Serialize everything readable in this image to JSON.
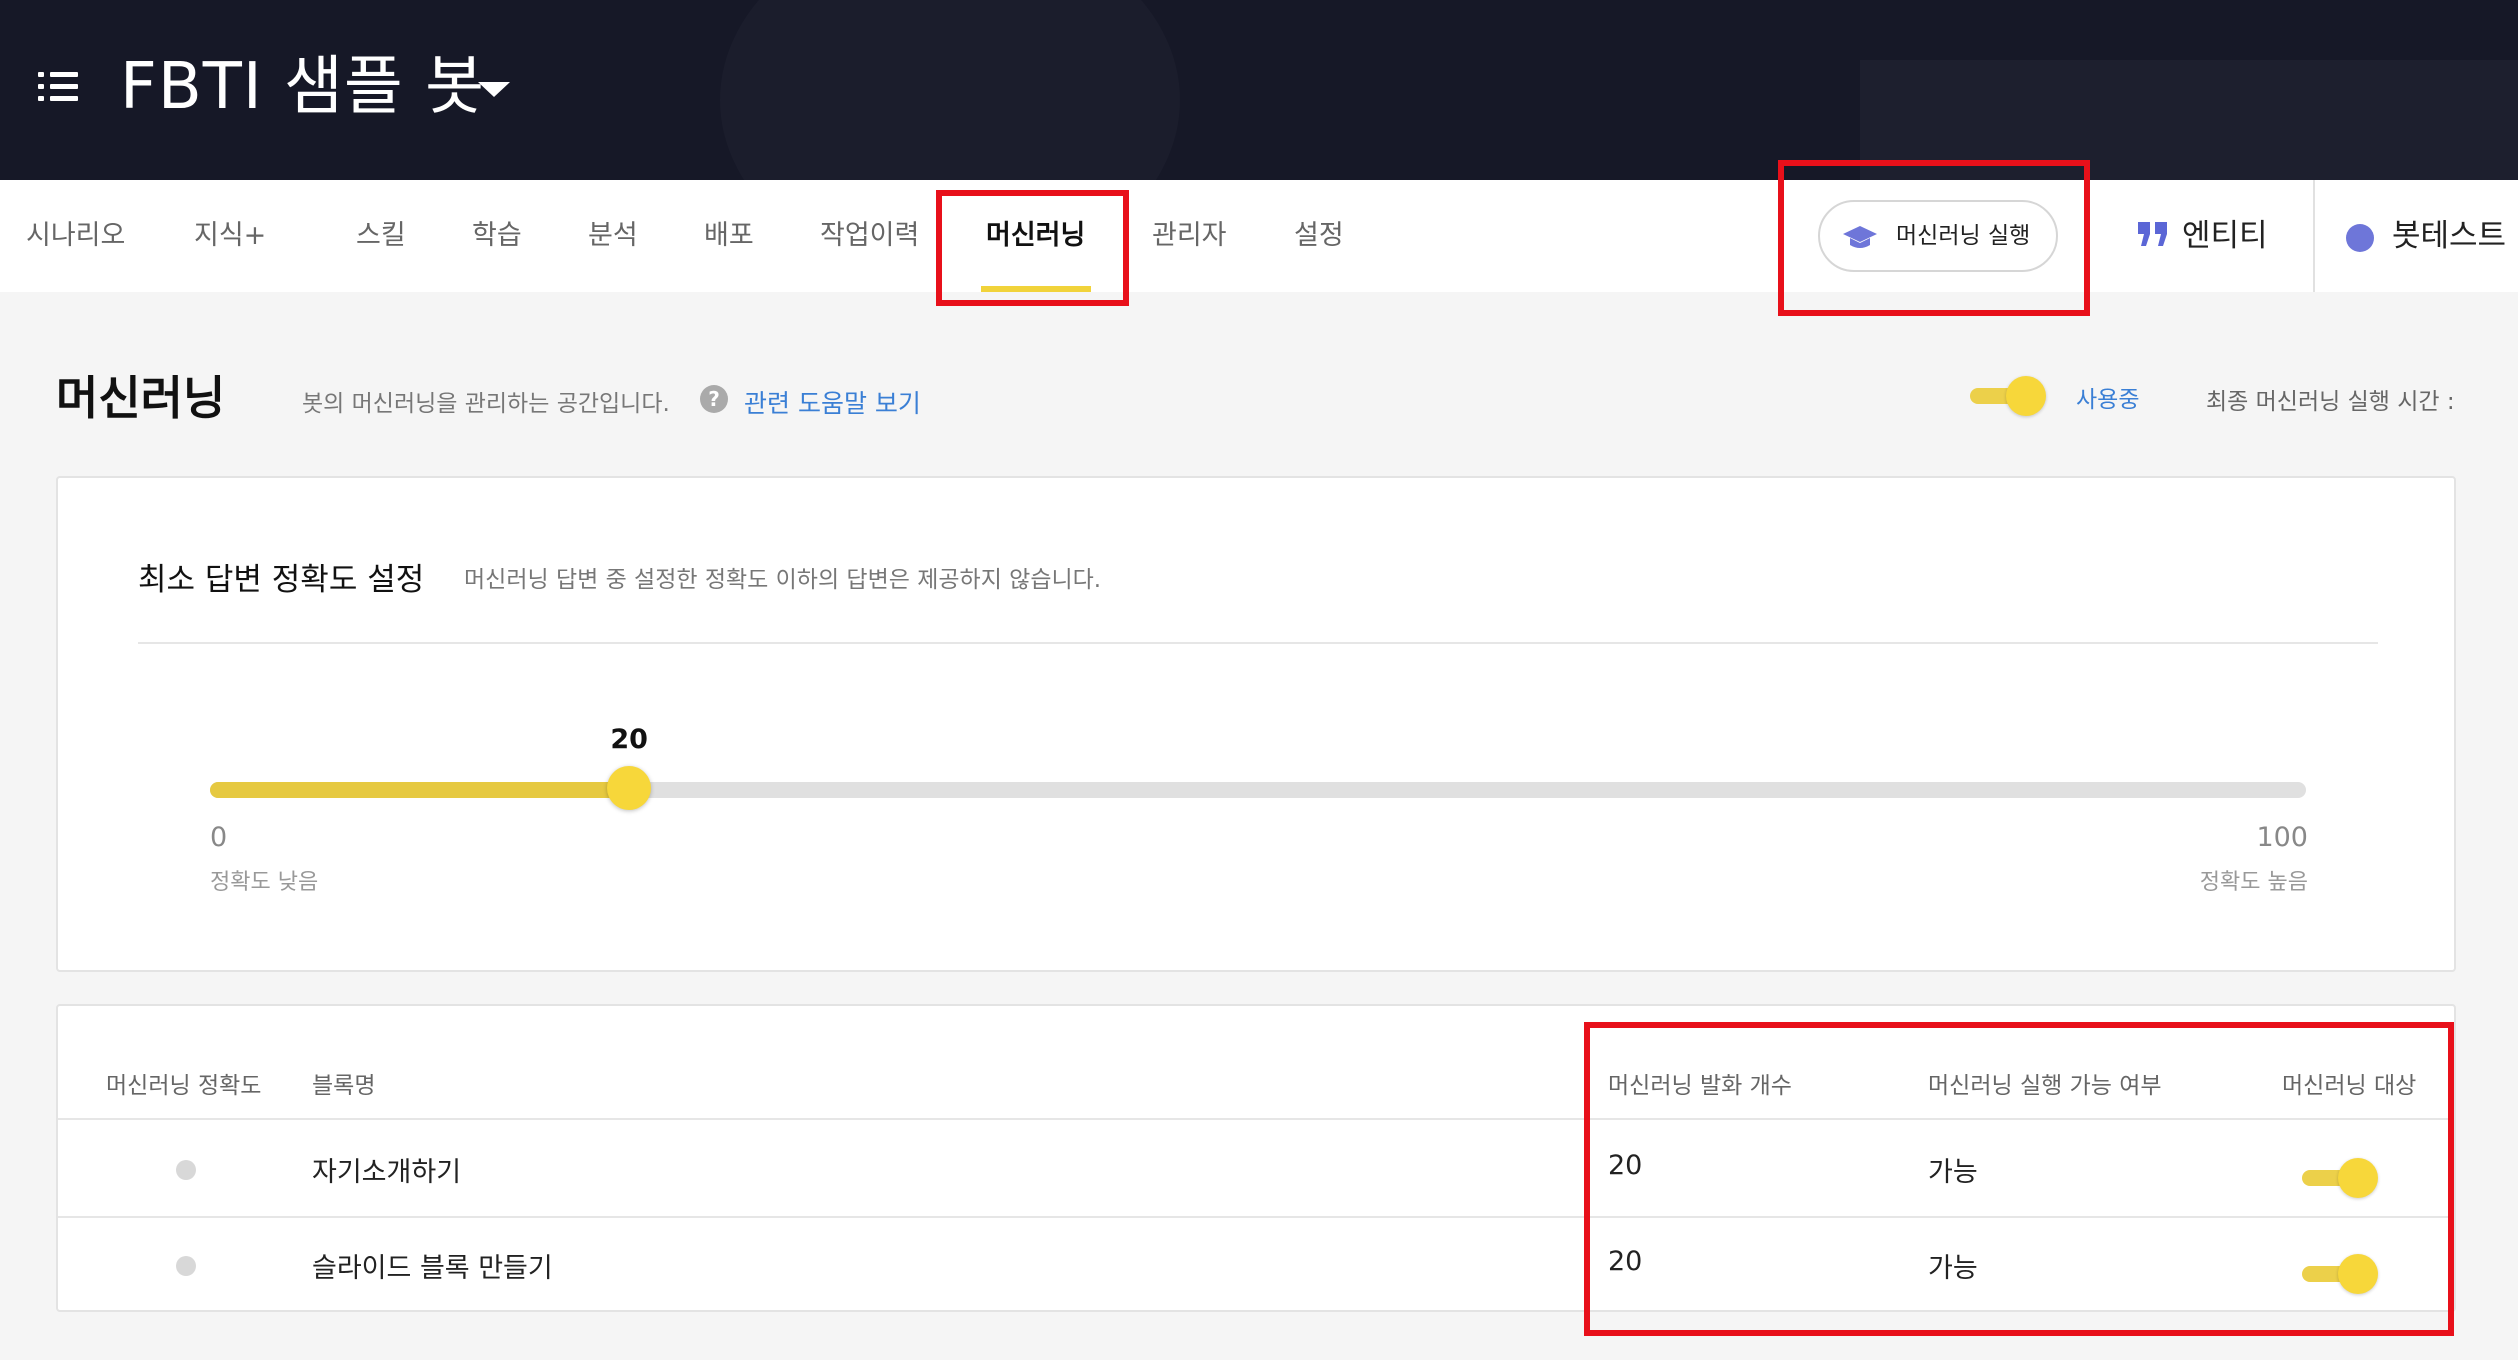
{
  "header": {
    "bot_name": "FBTI 샘플 봇"
  },
  "nav": {
    "tabs": [
      {
        "label": "시나리오"
      },
      {
        "label": "지식+"
      },
      {
        "label": "스킬"
      },
      {
        "label": "학습"
      },
      {
        "label": "분석"
      },
      {
        "label": "배포"
      },
      {
        "label": "작업이력"
      },
      {
        "label": "머신러닝",
        "active": true
      },
      {
        "label": "관리자"
      },
      {
        "label": "설정"
      }
    ],
    "ml_run_label": "머신러닝 실행",
    "entity_label": "엔티티",
    "bottest_label": "봇테스트"
  },
  "page": {
    "title": "머신러닝",
    "description": "봇의 머신러닝을 관리하는 공간입니다.",
    "help_link": "관련 도움말 보기",
    "use_status": "사용중",
    "use_enabled": true,
    "last_run_label": "최종 머신러닝 실행 시간 :"
  },
  "accuracy": {
    "title": "최소 답변 정확도 설정",
    "description": "머신러닝 답변 중 설정한 정확도 이하의 답변은 제공하지 않습니다.",
    "value": "20",
    "min": "0",
    "max": "100",
    "min_label": "정확도 낮음",
    "max_label": "정확도 높음"
  },
  "table": {
    "headers": {
      "accuracy": "머신러닝 정확도",
      "block": "블록명",
      "utterances": "머신러닝 발화 개수",
      "runnable": "머신러닝 실행 가능 여부",
      "target": "머신러닝 대상"
    },
    "rows": [
      {
        "block": "자기소개하기",
        "utterances": "20",
        "runnable": "가능",
        "target": true
      },
      {
        "block": "슬라이드 블록 만들기",
        "utterances": "20",
        "runnable": "가능",
        "target": true
      }
    ]
  },
  "colors": {
    "header_bg": "#161827",
    "accent_yellow": "#f7d73a",
    "link_blue": "#3a7fd5",
    "highlight_red": "#e8101a"
  }
}
